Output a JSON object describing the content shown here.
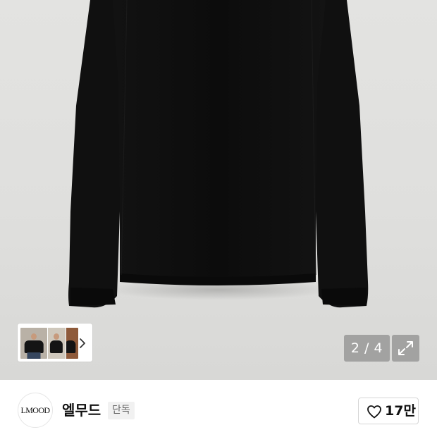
{
  "gallery": {
    "pager_text": "2 / 4",
    "thumbnails": [
      "thumbnail-1",
      "thumbnail-2",
      "thumbnail-3"
    ],
    "icons": {
      "next": "chevron-right-icon",
      "expand": "expand-icon"
    },
    "background_color": "#e0e0de",
    "product_color": "#0f0f0f"
  },
  "brand": {
    "logo_text": "LMOOD",
    "name": "엘무드",
    "badge": "단독"
  },
  "like": {
    "icon": "heart-outline-icon",
    "count": "17만"
  }
}
